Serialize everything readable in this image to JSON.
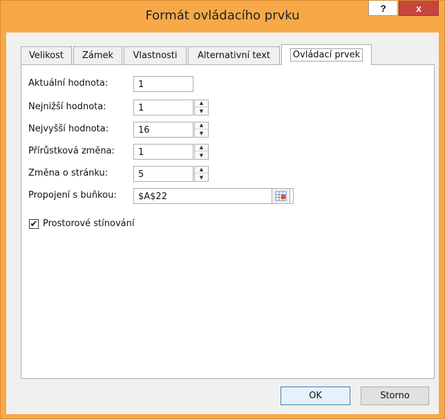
{
  "window": {
    "title": "Formát ovládacího prvku",
    "help_label": "?",
    "close_label": "x"
  },
  "tabs": [
    {
      "label": "Velikost",
      "active": false
    },
    {
      "label": "Zámek",
      "active": false
    },
    {
      "label": "Vlastnosti",
      "active": false
    },
    {
      "label": "Alternativní text",
      "active": false
    },
    {
      "label": "Ovládací prvek",
      "active": true
    }
  ],
  "form": {
    "current_value": {
      "label": "Aktuální hodnota:",
      "value": "1"
    },
    "min_value": {
      "label": "Nejnižší hodnota:",
      "value": "1"
    },
    "max_value": {
      "label": "Nejvyšší hodnota:",
      "value": "16"
    },
    "increment": {
      "label": "Přírůstková změna:",
      "value": "1"
    },
    "page_change": {
      "label": "Změna o stránku:",
      "value": "5"
    },
    "cell_link": {
      "label": "Propojení s buňkou:",
      "value": "$A$22"
    },
    "shading": {
      "label": "Prostorové stínování",
      "checked": true,
      "check_glyph": "✔"
    }
  },
  "spinner": {
    "up_glyph": "▲",
    "down_glyph": "▼"
  },
  "footer": {
    "ok_label": "OK",
    "cancel_label": "Storno"
  },
  "colors": {
    "titlebar": "#f7a948",
    "close_button": "#c7463c",
    "default_button_border": "#3c7fb1"
  }
}
